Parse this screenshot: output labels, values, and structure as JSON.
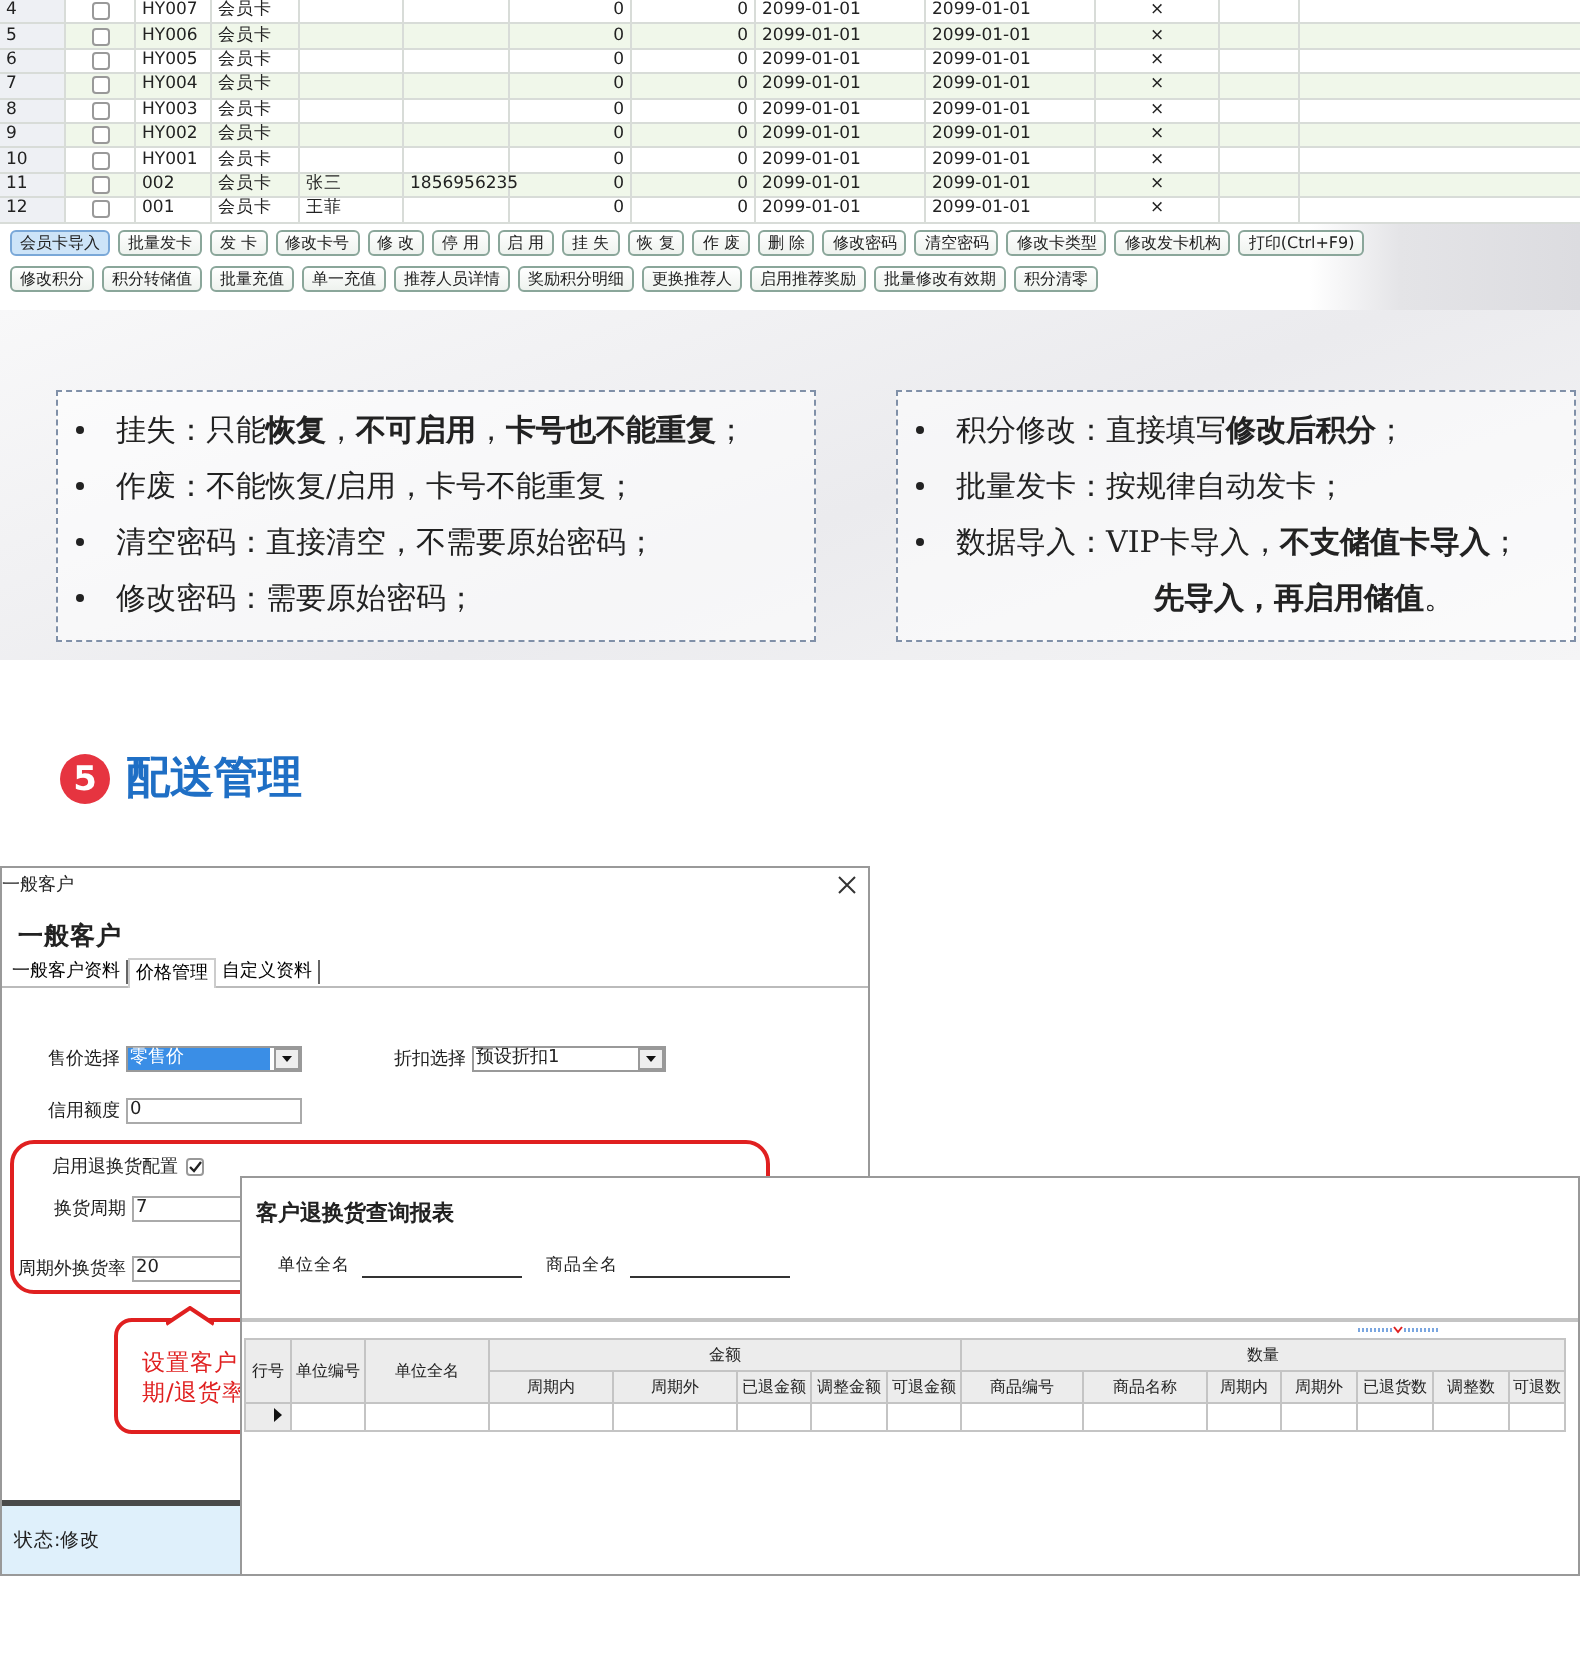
{
  "member_table": {
    "rows": [
      {
        "row_number": "4",
        "checked": false,
        "column_3": "HY007",
        "column_4": "会员卡",
        "column_7": "0",
        "column_8": "0",
        "column_9": "2099-01-01",
        "column_10": "2099-01-01",
        "column_11": "×"
      },
      {
        "row_number": "5",
        "checked": false,
        "column_3": "HY006",
        "column_4": "会员卡",
        "column_7": "0",
        "column_8": "0",
        "column_9": "2099-01-01",
        "column_10": "2099-01-01",
        "column_11": "×"
      },
      {
        "row_number": "6",
        "checked": false,
        "column_3": "HY005",
        "column_4": "会员卡",
        "column_7": "0",
        "column_8": "0",
        "column_9": "2099-01-01",
        "column_10": "2099-01-01",
        "column_11": "×"
      },
      {
        "row_number": "7",
        "checked": false,
        "column_3": "HY004",
        "column_4": "会员卡",
        "column_7": "0",
        "column_8": "0",
        "column_9": "2099-01-01",
        "column_10": "2099-01-01",
        "column_11": "×"
      },
      {
        "row_number": "8",
        "checked": false,
        "column_3": "HY003",
        "column_4": "会员卡",
        "column_7": "0",
        "column_8": "0",
        "column_9": "2099-01-01",
        "column_10": "2099-01-01",
        "column_11": "×"
      },
      {
        "row_number": "9",
        "checked": false,
        "column_3": "HY002",
        "column_4": "会员卡",
        "column_7": "0",
        "column_8": "0",
        "column_9": "2099-01-01",
        "column_10": "2099-01-01",
        "column_11": "×"
      },
      {
        "row_number": "10",
        "checked": false,
        "column_3": "HY001",
        "column_4": "会员卡",
        "column_7": "0",
        "column_8": "0",
        "column_9": "2099-01-01",
        "column_10": "2099-01-01",
        "column_11": "×"
      },
      {
        "row_number": "11",
        "checked": false,
        "column_3": "002",
        "column_4": "会员卡",
        "column_5": "张三",
        "column_6": "1856956235",
        "column_7": "0",
        "column_8": "0",
        "column_9": "2099-01-01",
        "column_10": "2099-01-01",
        "column_11": "×"
      },
      {
        "row_number": "12",
        "checked": false,
        "column_3": "001",
        "column_4": "会员卡",
        "column_5": "王菲",
        "column_7": "0",
        "column_8": "0",
        "column_9": "2099-01-01",
        "column_10": "2099-01-01",
        "column_11": "×"
      }
    ]
  },
  "toolbar": {
    "rows": [
      {
        "buttons": [
          {
            "label": "会员卡导入",
            "selected": true
          },
          {
            "label": "批量发卡",
            "selected": false
          },
          {
            "label": "发 卡",
            "selected": false
          },
          {
            "label": "修改卡号",
            "selected": false
          },
          {
            "label": "修 改",
            "selected": false
          },
          {
            "label": "停 用",
            "selected": false
          },
          {
            "label": "启 用",
            "selected": false
          },
          {
            "label": "挂 失",
            "selected": false
          },
          {
            "label": "恢 复",
            "selected": false
          },
          {
            "label": "作 废",
            "selected": false
          },
          {
            "label": "删 除",
            "selected": false
          },
          {
            "label": "修改密码",
            "selected": false
          },
          {
            "label": "清空密码",
            "selected": false
          },
          {
            "label": "修改卡类型",
            "selected": false
          },
          {
            "label": "修改发卡机构",
            "selected": false
          },
          {
            "label": "打印(Ctrl+F9)",
            "selected": false
          }
        ]
      },
      {
        "buttons": [
          {
            "label": "修改积分",
            "selected": false
          },
          {
            "label": "积分转储值",
            "selected": false
          },
          {
            "label": "批量充值",
            "selected": false
          },
          {
            "label": "单一充值",
            "selected": false
          },
          {
            "label": "推荐人员详情",
            "selected": false
          },
          {
            "label": "奖励积分明细",
            "selected": false
          },
          {
            "label": "更换推荐人",
            "selected": false
          },
          {
            "label": "启用推荐奖励",
            "selected": false
          },
          {
            "label": "批量修改有效期",
            "selected": false
          },
          {
            "label": "积分清零",
            "selected": false
          }
        ]
      }
    ]
  },
  "notes": {
    "left": [
      {
        "kind": "bullet",
        "text": "挂失：只能**恢复**，**不可启用**，**卡号也不能重复**；"
      },
      {
        "kind": "bullet",
        "text": "作废：不能恢复/启用，卡号不能重复；"
      },
      {
        "kind": "bullet",
        "text": "清空密码：直接清空，不需要原始密码；"
      },
      {
        "kind": "bullet",
        "text": "修改密码：需要原始密码；"
      }
    ],
    "right": [
      {
        "kind": "bullet",
        "text": "积分修改：直接填写**修改后积分**；"
      },
      {
        "kind": "bullet",
        "text": "批量发卡：按规律自动发卡；"
      },
      {
        "kind": "bullet",
        "text": "数据导入：VIP卡导入，**不支储值卡导入**；"
      },
      {
        "kind": "continuation",
        "text": "**先导入，再启用储值**。"
      }
    ]
  },
  "section": {
    "number": "5",
    "title": "配送管理"
  },
  "customer_dialog": {
    "window_title": "一般客户",
    "heading": "一般客户",
    "tabs": [
      {
        "label": "一般客户资料",
        "selected": false
      },
      {
        "label": "价格管理",
        "selected": true
      },
      {
        "label": "自定义资料",
        "selected": false
      }
    ],
    "price_select": {
      "label": "售价选择",
      "value": "零售价",
      "focused": true
    },
    "discount_select": {
      "label": "折扣选择",
      "value": "预设折扣1",
      "focused": false
    },
    "credit_limit": {
      "label": "信用额度",
      "value": "0"
    },
    "return_config": {
      "label": "启用退换货配置",
      "checked": true
    },
    "exchange_period": {
      "label": "换货周期",
      "value": "7"
    },
    "out_of_period_rate": {
      "label": "周期外换货率",
      "value": "20"
    },
    "callout": [
      "设置客户",
      "期/退货率"
    ],
    "status": "状态:修改"
  },
  "report_window": {
    "title": "客户退换货查询报表",
    "filters": [
      {
        "label": "单位全名"
      },
      {
        "label": "商品全名"
      }
    ],
    "table": {
      "fixed_columns": [
        "行号",
        "单位编号",
        "单位全名"
      ],
      "groups": [
        {
          "label": "金额",
          "columns": [
            "周期内",
            "周期外",
            "已退金额",
            "调整金额",
            "可退金额"
          ]
        },
        {
          "label": "数量",
          "columns": [
            "商品编号",
            "商品名称",
            "周期内",
            "周期外",
            "已退货数",
            "调整数",
            "可退数"
          ]
        }
      ]
    }
  }
}
